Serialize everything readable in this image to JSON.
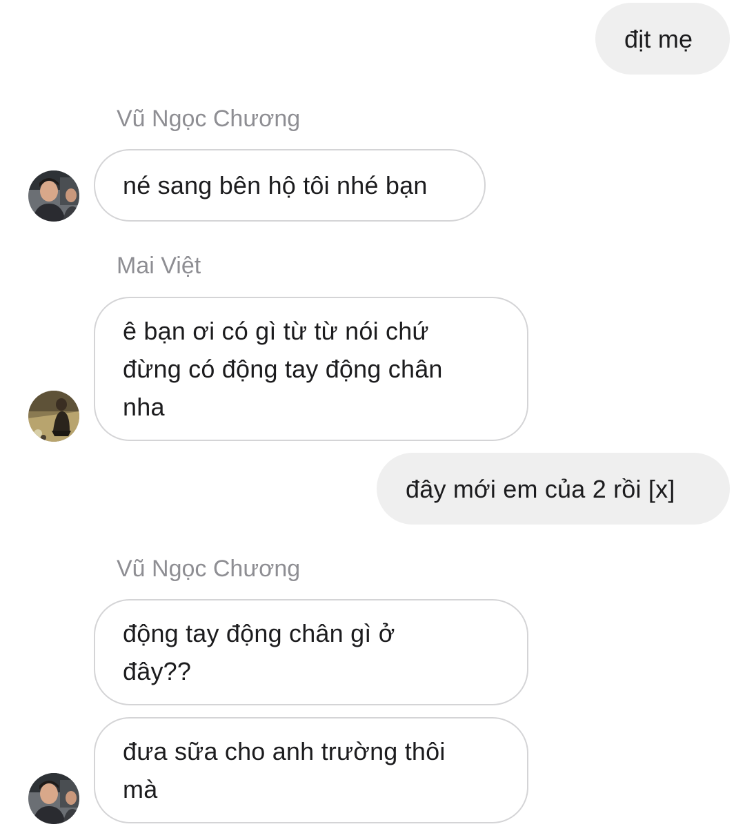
{
  "conversation": {
    "messages": [
      {
        "direction": "outgoing",
        "text": "địt mẹ"
      },
      {
        "direction": "incoming",
        "sender": "Vũ Ngọc Chương",
        "text": "né sang bên hộ tôi nhé bạn",
        "avatar": "avatar-vu-ngoc-chuong"
      },
      {
        "direction": "incoming",
        "sender": "Mai Việt",
        "lines": [
          "ê bạn ơi có gì từ từ nói chứ",
          "đừng có động tay động chân",
          "nha"
        ],
        "avatar": "avatar-mai-viet"
      },
      {
        "direction": "outgoing",
        "text": "đây mới em của 2 rồi [x]"
      },
      {
        "direction": "incoming",
        "sender": "Vũ Ngọc Chương",
        "lines": [
          "động tay động chân gì ở",
          "đây??"
        ]
      },
      {
        "direction": "incoming",
        "lines": [
          "đưa sữa cho anh trường thôi",
          "mà"
        ],
        "avatar": "avatar-vu-ngoc-chuong"
      }
    ]
  },
  "colors": {
    "outgoing_bubble": "#efefef",
    "incoming_border": "#d4d4d6",
    "sender_name": "#8e8e93",
    "text": "#1c1c1e"
  }
}
